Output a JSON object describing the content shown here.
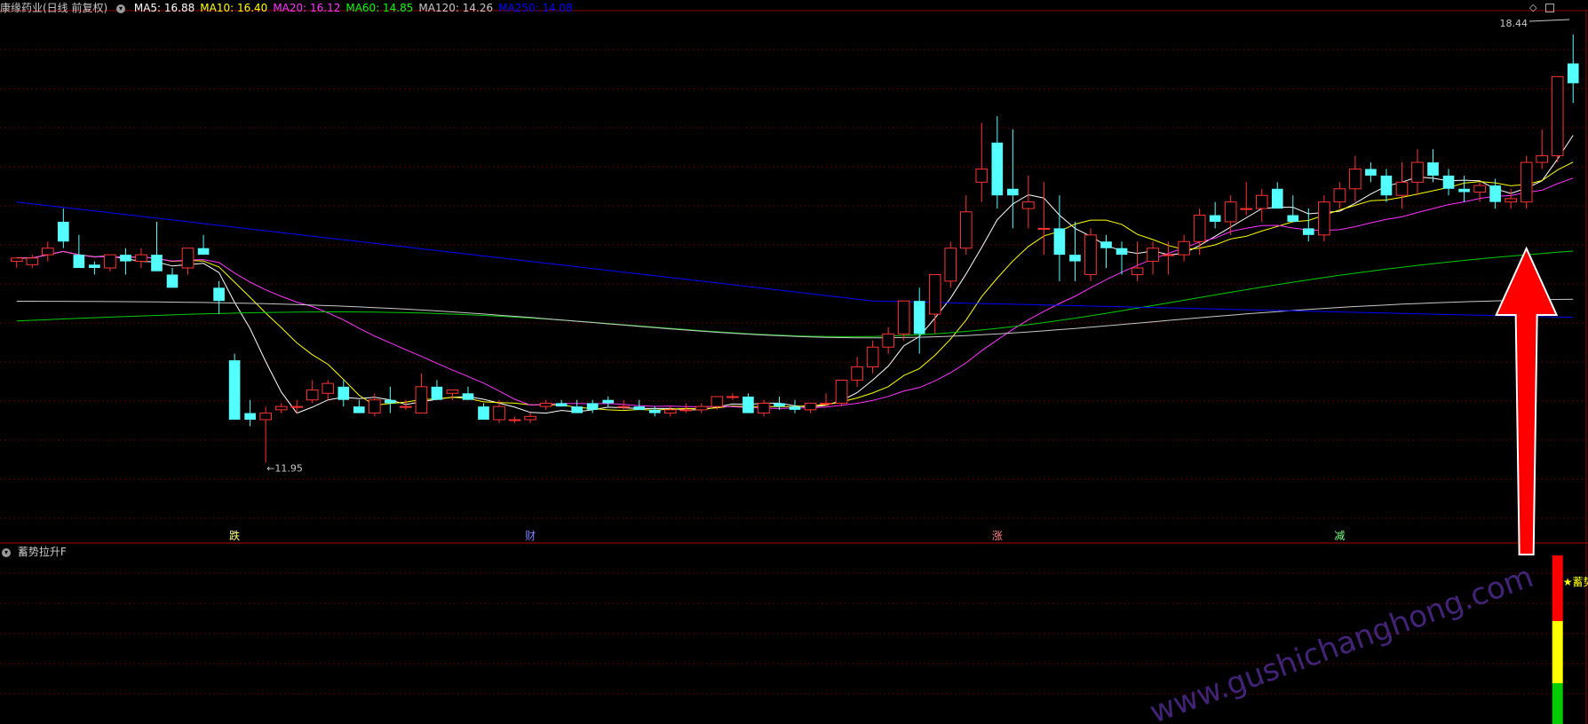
{
  "header": {
    "title": "康缘药业(日线 前复权)",
    "ma": [
      {
        "label": "MA5: 16.88",
        "color": "#ffffff"
      },
      {
        "label": "MA10: 16.40",
        "color": "#ffff00"
      },
      {
        "label": "MA20: 16.12",
        "color": "#ff33ff"
      },
      {
        "label": "MA60: 14.85",
        "color": "#00ff00"
      },
      {
        "label": "MA120: 14.26",
        "color": "#c8c8c8"
      },
      {
        "label": "MA250: 14.08",
        "color": "#0000ff"
      }
    ]
  },
  "indicator": {
    "title": "蓄势拉升F",
    "signal_label": "★蓄势拉升"
  },
  "markers": {
    "high_label": "18.44",
    "low_label": "←11.95",
    "events": [
      "跌",
      "财",
      "涨",
      "减"
    ]
  },
  "watermark": "www.gushichanghong.com",
  "chart_data": {
    "type": "candlestick",
    "title": "康缘药业(日线 前复权)",
    "xlabel": "",
    "ylabel": "",
    "ylim": [
      11.0,
      18.8
    ],
    "grid": true,
    "price_high": 18.44,
    "price_low": 11.95,
    "candles": [
      [
        15.0,
        15.05,
        14.9,
        15.05
      ],
      [
        14.95,
        15.1,
        14.9,
        15.05
      ],
      [
        15.1,
        15.3,
        15.0,
        15.2
      ],
      [
        15.6,
        15.8,
        15.2,
        15.3
      ],
      [
        15.1,
        15.4,
        14.9,
        14.9
      ],
      [
        14.95,
        15.0,
        14.8,
        14.9
      ],
      [
        14.9,
        15.1,
        14.85,
        15.1
      ],
      [
        15.1,
        15.2,
        14.8,
        15.0
      ],
      [
        15.0,
        15.2,
        14.9,
        15.1
      ],
      [
        15.1,
        15.6,
        15.0,
        14.85
      ],
      [
        14.8,
        14.9,
        14.6,
        14.6
      ],
      [
        14.9,
        15.2,
        14.8,
        15.2
      ],
      [
        15.2,
        15.4,
        15.1,
        15.1
      ],
      [
        14.6,
        14.7,
        14.2,
        14.4
      ],
      [
        13.5,
        13.6,
        12.6,
        12.6
      ],
      [
        12.7,
        12.9,
        12.5,
        12.6
      ],
      [
        12.6,
        12.8,
        11.95,
        12.7
      ],
      [
        12.75,
        12.85,
        12.7,
        12.8
      ],
      [
        12.8,
        12.9,
        12.7,
        12.8
      ],
      [
        12.9,
        13.2,
        12.85,
        13.05
      ],
      [
        13.0,
        13.2,
        12.9,
        13.15
      ],
      [
        13.1,
        13.2,
        12.8,
        12.9
      ],
      [
        12.8,
        12.9,
        12.7,
        12.7
      ],
      [
        12.7,
        13.0,
        12.65,
        12.9
      ],
      [
        12.9,
        13.1,
        12.7,
        12.85
      ],
      [
        12.8,
        12.9,
        12.75,
        12.8
      ],
      [
        12.7,
        13.3,
        12.7,
        13.1
      ],
      [
        13.1,
        13.2,
        12.9,
        12.9
      ],
      [
        13.0,
        13.05,
        12.9,
        13.05
      ],
      [
        13.0,
        13.1,
        12.9,
        12.9
      ],
      [
        12.8,
        12.85,
        12.6,
        12.6
      ],
      [
        12.6,
        12.9,
        12.55,
        12.8
      ],
      [
        12.6,
        12.65,
        12.55,
        12.6
      ],
      [
        12.6,
        12.7,
        12.55,
        12.65
      ],
      [
        12.8,
        12.9,
        12.75,
        12.85
      ],
      [
        12.85,
        12.9,
        12.8,
        12.8
      ],
      [
        12.8,
        12.9,
        12.7,
        12.7
      ],
      [
        12.85,
        12.9,
        12.7,
        12.75
      ],
      [
        12.9,
        12.95,
        12.8,
        12.85
      ],
      [
        12.8,
        12.9,
        12.75,
        12.8
      ],
      [
        12.8,
        12.9,
        12.75,
        12.75
      ],
      [
        12.75,
        12.8,
        12.65,
        12.7
      ],
      [
        12.7,
        12.8,
        12.65,
        12.75
      ],
      [
        12.75,
        12.85,
        12.7,
        12.75
      ],
      [
        12.75,
        12.85,
        12.7,
        12.8
      ],
      [
        12.8,
        12.95,
        12.75,
        12.95
      ],
      [
        12.95,
        13.0,
        12.9,
        12.95
      ],
      [
        12.95,
        13.0,
        12.7,
        12.7
      ],
      [
        12.7,
        12.9,
        12.65,
        12.85
      ],
      [
        12.85,
        12.95,
        12.75,
        12.8
      ],
      [
        12.8,
        12.9,
        12.7,
        12.75
      ],
      [
        12.75,
        12.85,
        12.7,
        12.85
      ],
      [
        12.85,
        13.0,
        12.8,
        12.85
      ],
      [
        12.85,
        13.2,
        12.8,
        13.2
      ],
      [
        13.2,
        13.55,
        13.1,
        13.4
      ],
      [
        13.4,
        13.8,
        13.3,
        13.7
      ],
      [
        13.7,
        14.0,
        13.6,
        13.9
      ],
      [
        13.9,
        14.4,
        13.8,
        14.4
      ],
      [
        14.4,
        14.6,
        13.6,
        13.9
      ],
      [
        14.2,
        14.8,
        13.9,
        14.8
      ],
      [
        14.7,
        15.3,
        14.6,
        15.2
      ],
      [
        15.2,
        16.0,
        15.1,
        15.75
      ],
      [
        16.2,
        17.1,
        15.9,
        16.4
      ],
      [
        16.8,
        17.2,
        15.8,
        16.0
      ],
      [
        16.1,
        17.0,
        15.5,
        16.0
      ],
      [
        15.8,
        16.3,
        15.5,
        15.9
      ],
      [
        15.5,
        16.2,
        15.1,
        15.5
      ],
      [
        15.5,
        16.0,
        14.7,
        15.1
      ],
      [
        15.1,
        15.6,
        14.7,
        15.0
      ],
      [
        14.8,
        15.5,
        14.7,
        15.4
      ],
      [
        15.3,
        15.4,
        14.9,
        15.2
      ],
      [
        15.2,
        15.3,
        14.8,
        15.1
      ],
      [
        14.8,
        15.3,
        14.7,
        14.9
      ],
      [
        15.0,
        15.3,
        14.8,
        15.2
      ],
      [
        15.1,
        15.3,
        14.8,
        15.1
      ],
      [
        15.1,
        15.4,
        15.0,
        15.3
      ],
      [
        15.3,
        15.8,
        15.1,
        15.7
      ],
      [
        15.7,
        15.9,
        15.5,
        15.6
      ],
      [
        15.6,
        16.0,
        15.4,
        15.9
      ],
      [
        15.8,
        16.2,
        15.7,
        15.8
      ],
      [
        15.8,
        16.1,
        15.6,
        16.0
      ],
      [
        16.1,
        16.2,
        15.8,
        15.8
      ],
      [
        15.7,
        16.0,
        15.6,
        15.6
      ],
      [
        15.5,
        15.8,
        15.3,
        15.4
      ],
      [
        15.4,
        16.0,
        15.3,
        15.9
      ],
      [
        15.9,
        16.2,
        15.8,
        16.1
      ],
      [
        16.1,
        16.6,
        15.9,
        16.4
      ],
      [
        16.4,
        16.5,
        16.2,
        16.3
      ],
      [
        16.3,
        16.4,
        15.9,
        16.0
      ],
      [
        16.0,
        16.5,
        15.8,
        16.2
      ],
      [
        16.2,
        16.7,
        16.0,
        16.5
      ],
      [
        16.5,
        16.7,
        16.2,
        16.3
      ],
      [
        16.3,
        16.4,
        16.0,
        16.1
      ],
      [
        16.1,
        16.3,
        15.9,
        16.05
      ],
      [
        16.05,
        16.2,
        15.9,
        16.15
      ],
      [
        16.15,
        16.25,
        15.8,
        15.9
      ],
      [
        15.9,
        16.1,
        15.8,
        15.95
      ],
      [
        15.9,
        16.6,
        15.8,
        16.5
      ],
      [
        16.5,
        17.0,
        16.4,
        16.6
      ],
      [
        16.6,
        17.8,
        16.5,
        17.8
      ],
      [
        18.0,
        18.44,
        17.4,
        17.7
      ]
    ],
    "marker_indices": {
      "low": 16,
      "die": 14,
      "cai": 33,
      "zhang": 63,
      "jian": 85
    }
  }
}
